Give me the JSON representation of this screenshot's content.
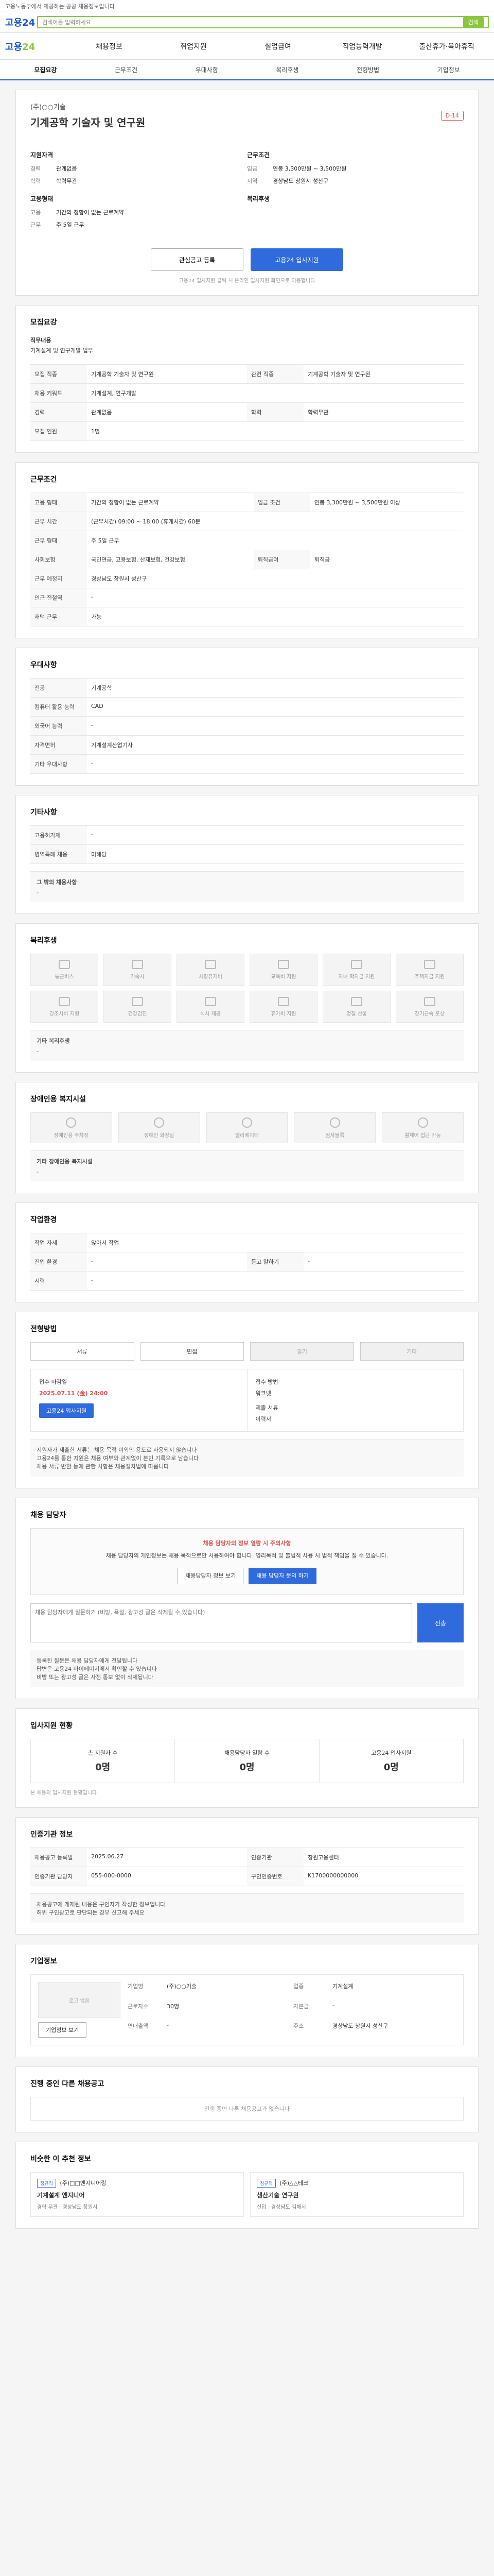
{
  "notice": "고용노동부에서 제공하는 공공 채용정보입니다",
  "header": {
    "logo": "고용24",
    "search_placeholder": "검색어를 입력하세요",
    "search_cta": "검색"
  },
  "nav": {
    "brand_a": "고용",
    "brand_b": "24",
    "items": [
      "채용정보",
      "취업지원",
      "실업급여",
      "직업능력개발",
      "출산휴가·육아휴직"
    ]
  },
  "tabs": [
    "모집요강",
    "근무조건",
    "우대사항",
    "복리후생",
    "전형방법",
    "기업정보"
  ],
  "summary": {
    "company": "(주)○○기술",
    "title": "기계공학 기술자 및 연구원",
    "dday": "D-14",
    "req_title": "지원자격",
    "req": [
      {
        "k": "경력",
        "v": "관계없음"
      },
      {
        "k": "학력",
        "v": "학력무관"
      }
    ],
    "cond_title": "근무조건",
    "cond": [
      {
        "k": "임금",
        "v": "연봉 3,300만원 ~ 3,500만원"
      },
      {
        "k": "지역",
        "v": "경상남도 창원시 성산구"
      }
    ],
    "emp_title": "고용형태",
    "emp": [
      {
        "k": "고용",
        "v": "기간의 정함이 없는 근로계약"
      },
      {
        "k": "근무",
        "v": "주 5일 근무"
      }
    ],
    "welfare_title": "복리후생"
  },
  "buttons": {
    "scrap": "관심공고 등록",
    "apply": "고용24 입사지원",
    "note": "고용24 입사지원 클릭 시 온라인 입사지원 화면으로 이동합니다"
  },
  "recruit": {
    "title": "모집요강",
    "content_title": "직무내용",
    "content": "기계설계 및 연구개발 업무",
    "rows": [
      {
        "k": "모집 직종",
        "v": "기계공학 기술자 및 연구원"
      },
      {
        "k": "관련 직종",
        "v": "기계공학 기술자 및 연구원"
      },
      {
        "k": "채용 키워드",
        "v": "기계설계, 연구개발"
      },
      {
        "k": "경력",
        "v": "관계없음"
      },
      {
        "k": "학력",
        "v": "학력무관"
      },
      {
        "k": "모집 인원",
        "v": "1명"
      }
    ]
  },
  "work": {
    "title": "근무조건",
    "rows": [
      {
        "k": "고용 형태",
        "v": "기간의 정함이 없는 근로계약"
      },
      {
        "k": "임금 조건",
        "v": "연봉 3,300만원 ~ 3,500만원 이상"
      },
      {
        "k": "근무 시간",
        "v": "(근무시간) 09:00 ~ 18:00 (휴게시간) 60분"
      },
      {
        "k": "근무 형태",
        "v": "주 5일 근무"
      },
      {
        "k": "사회보험",
        "v": "국민연금, 고용보험, 산재보험, 건강보험"
      },
      {
        "k": "퇴직급여",
        "v": "퇴직금"
      },
      {
        "k": "근무 예정지",
        "v": "경상남도 창원시 성산구"
      },
      {
        "k": "인근 전철역",
        "v": "-"
      },
      {
        "k": "재택 근무",
        "v": "가능"
      }
    ]
  },
  "prefer": {
    "title": "우대사항",
    "rows": [
      {
        "k": "전공",
        "v": "기계공학"
      },
      {
        "k": "컴퓨터 활용 능력",
        "v": "CAD"
      },
      {
        "k": "외국어 능력",
        "v": "-"
      },
      {
        "k": "자격면허",
        "v": "기계설계산업기사"
      },
      {
        "k": "기타 우대사항",
        "v": "-"
      }
    ]
  },
  "extra": {
    "title": "기타사항",
    "rows": [
      {
        "k": "고용허가제",
        "v": "-"
      },
      {
        "k": "병역특례 채용",
        "v": "미해당"
      }
    ],
    "more_title": "그 밖의 채용사항",
    "more_body": "-"
  },
  "welfare": {
    "title": "복리후생",
    "items": [
      "통근버스",
      "기숙사",
      "차량유지비",
      "교육비 지원",
      "자녀 학자금 지원",
      "주택자금 지원",
      "경조사비 지원",
      "건강검진",
      "식사 제공",
      "휴가비 지원",
      "명절 선물",
      "장기근속 포상"
    ],
    "note_title": "기타 복리후생",
    "note_body": "-"
  },
  "accessibility": {
    "title": "장애인용 복지시설",
    "items": [
      "장애인용 주차장",
      "장애인 화장실",
      "엘리베이터",
      "점자블록",
      "휠체어 접근 가능"
    ],
    "note_title": "기타 장애인용 복지시설",
    "note_body": "-"
  },
  "env": {
    "title": "작업환경",
    "rows": [
      {
        "k": "작업 자세",
        "v": "앉아서 작업"
      },
      {
        "k": "진입 환경",
        "v": "-"
      },
      {
        "k": "듣고 말하기",
        "v": "-"
      },
      {
        "k": "시력",
        "v": "-"
      }
    ]
  },
  "method": {
    "title": "전형방법",
    "items": [
      "서류",
      "면접",
      "필기",
      "기타"
    ],
    "receipt_title": "접수 마감일",
    "deadline": "2025.07.11 (金) 24:00",
    "apply_btn": "고용24 입사지원",
    "method_title": "접수 방법",
    "method_value": "워크넷",
    "docs_title": "제출 서류",
    "docs_value": "이력서",
    "notes": [
      "지원자가 제출한 서류는 채용 목적 이외의 용도로 사용되지 않습니다",
      "고용24를 통한 지원은 채용 여부와 관계없이 본인 기록으로 남습니다",
      "채용 서류 반환 등에 관한 사항은 채용절차법에 따릅니다"
    ]
  },
  "contact": {
    "title": "채용 담당자",
    "warn_title": "채용 담당자의 정보 열람 시 주의사항",
    "warn_body": "채용 담당자의 개인정보는 채용 목적으로만 사용하여야 합니다. 영리목적 및 불법적 사용 시 법적 책임을 질 수 있습니다.",
    "btn_view": "채용담당자 정보 보기",
    "btn_inquiry": "채용 담당자 문의 하기",
    "qa_placeholder": "채용 담당자에게 질문하기 (비방, 욕설, 광고성 글은 삭제될 수 있습니다)",
    "qa_submit": "전송",
    "notes": [
      "등록된 질문은 채용 담당자에게 전달됩니다",
      "답변은 고용24 마이페이지에서 확인할 수 있습니다",
      "비방 또는 광고성 글은 사전 통보 없이 삭제됩니다"
    ]
  },
  "stats": {
    "title": "입사지원 현황",
    "items": [
      {
        "k": "총 지원자 수",
        "v": "0명"
      },
      {
        "k": "채용담당자 열람 수",
        "v": "0명"
      },
      {
        "k": "고용24 입사지원",
        "v": "0명"
      }
    ],
    "note": "본 채용의 입사지원 현황입니다"
  },
  "info": {
    "title": "인증기관 정보",
    "rows": [
      {
        "k": "채용공고 등록일",
        "v": "2025.06.27",
        "k2": "인증기관",
        "v2": "창원고용센터"
      },
      {
        "k": "인증기관 담당자",
        "v": "055-000-0000",
        "k2": "구인인증번호",
        "v2": "K1700000000000"
      }
    ],
    "notes": [
      "채용공고에 게재된 내용은 구인자가 작성한 정보입니다",
      "허위 구인광고로 판단되는 경우 신고해 주세요"
    ]
  },
  "company": {
    "title": "기업정보",
    "logo_placeholder": "로고 없음",
    "logo_btn": "기업정보 보기",
    "rows": [
      {
        "k": "기업명",
        "v": "(주)○○기술",
        "k2": "업종",
        "v2": "기계설계"
      },
      {
        "k": "근로자수",
        "v": "30명",
        "k2": "자본금",
        "v2": "-"
      },
      {
        "k": "연매출액",
        "v": "-",
        "k2": "주소",
        "v2": "경상남도 창원시 성산구"
      }
    ]
  },
  "related": {
    "title": "진행 중인 다른 채용공고",
    "empty": "진행 중인 다른 채용공고가 없습니다"
  },
  "recommend": {
    "title": "비슷한 이 추천 정보",
    "cards": [
      {
        "tag": "정규직",
        "company": "(주)□□엔지니어링",
        "title": "기계설계 엔지니어",
        "meta": "경력 무관 · 경상남도 창원시"
      },
      {
        "tag": "정규직",
        "company": "(주)△△테크",
        "title": "생산기술 연구원",
        "meta": "신입 · 경상남도 김해시"
      }
    ]
  }
}
